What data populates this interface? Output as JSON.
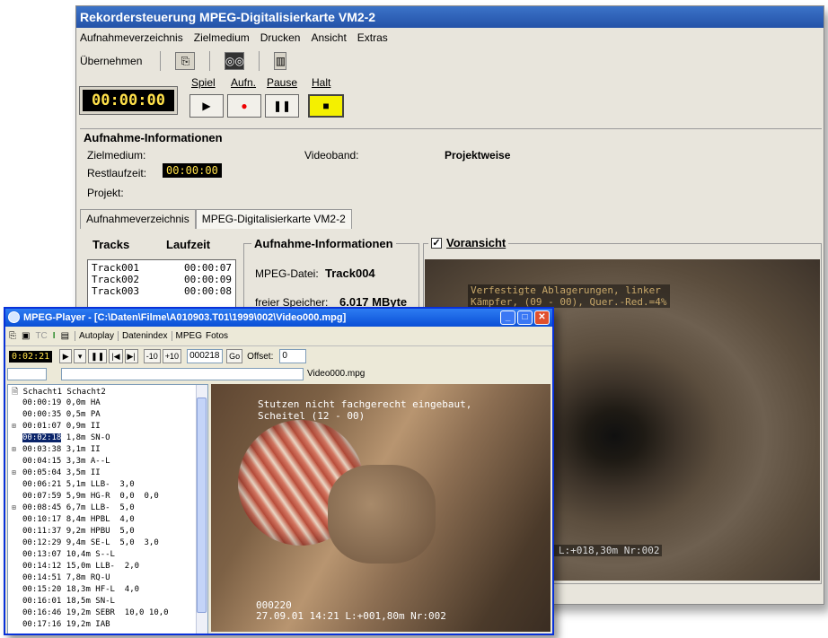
{
  "win1": {
    "title": "Rekordersteuerung MPEG-Digitalisierkarte VM2-2",
    "menu": [
      "Aufnahmeverzeichnis",
      "Zielmedium",
      "Drucken",
      "Ansicht",
      "Extras"
    ],
    "toolbar": {
      "uebernehmen": "Übernehmen"
    },
    "timecode": "00:00:00",
    "transport_labels": {
      "spiel": "Spiel",
      "aufn": "Aufn.",
      "pause": "Pause",
      "halt": "Halt"
    },
    "transport_symbols": {
      "play": "▶",
      "rec": "●",
      "pause": "❚❚",
      "stop": "■"
    },
    "aufnahme_info": {
      "title": "Aufnahme-Informationen",
      "zielmedium": "Zielmedium:",
      "videoband": "Videoband:",
      "projektweise": "Projektweise",
      "restlaufzeit": "Restlaufzeit:",
      "restlaufzeit_value": "00:00:00",
      "projekt": "Projekt:"
    },
    "tabs": [
      "Aufnahmeverzeichnis",
      "MPEG-Digitalisierkarte VM2-2"
    ],
    "tracks_header": {
      "tracks": "Tracks",
      "laufzeit": "Laufzeit"
    },
    "tracks": [
      {
        "name": "Track001",
        "time": "00:00:07"
      },
      {
        "name": "Track002",
        "time": "00:00:09"
      },
      {
        "name": "Track003",
        "time": "00:00:08"
      }
    ],
    "info2": {
      "title": "Aufnahme-Informationen",
      "mpeg_datei_label": "MPEG-Datei:",
      "mpeg_datei_value": "Track004",
      "speicher_label": "freier Speicher:",
      "speicher_value": "6.017 MByte"
    },
    "preview": {
      "label": "Voransicht",
      "checked": "✓",
      "osd_top": "Verfestigte Ablagerungen, linker\nKämpfer, (09 - 00), Quer.-Red.=4%",
      "osd_bottom": "34 L:+018,30m Nr:002"
    }
  },
  "win2": {
    "title": "MPEG-Player - [C:\\Daten\\Filme\\A010903.T01\\1999\\002\\Video000.mpg]",
    "toolbar": {
      "tc": "TC",
      "i": "I",
      "autoplay": "Autoplay",
      "datenindex": "Datenindex",
      "mpeg": "MPEG",
      "fotos": "Fotos"
    },
    "timecode": "0:02:21",
    "ctrl": {
      "play": "▶",
      "dropdown": "▾",
      "pause": "❚❚",
      "first": "|◀",
      "last": "▶|",
      "minus10": "-10",
      "plus10": "+10",
      "frame": "000218",
      "go": "Go",
      "offset_label": "Offset:",
      "offset_value": "0"
    },
    "filename": "Video000.mpg",
    "tree_root": "Schacht1 Schacht2",
    "tree": [
      {
        "tc": "00:00:19",
        "info": "0,0m HA",
        "exp": ""
      },
      {
        "tc": "00:00:35",
        "info": "0,5m PA",
        "exp": ""
      },
      {
        "tc": "00:01:07",
        "info": "0,9m II",
        "exp": "⊞"
      },
      {
        "tc": "00:02:18",
        "info": "1,8m SN-O",
        "exp": "",
        "selected": true
      },
      {
        "tc": "00:03:38",
        "info": "3,1m II",
        "exp": "⊞"
      },
      {
        "tc": "00:04:15",
        "info": "3,3m A--L",
        "exp": ""
      },
      {
        "tc": "00:05:04",
        "info": "3,5m II",
        "exp": "⊞"
      },
      {
        "tc": "00:06:21",
        "info": "5,1m LLB-  3,0",
        "exp": ""
      },
      {
        "tc": "00:07:59",
        "info": "5,9m HG-R  0,0  0,0",
        "exp": ""
      },
      {
        "tc": "00:08:45",
        "info": "6,7m LLB-  5,0",
        "exp": "⊞"
      },
      {
        "tc": "00:10:17",
        "info": "8,4m HPBL  4,0",
        "exp": ""
      },
      {
        "tc": "00:11:37",
        "info": "9,2m HPBU  5,0",
        "exp": ""
      },
      {
        "tc": "00:12:29",
        "info": "9,4m SE-L  5,0  3,0",
        "exp": ""
      },
      {
        "tc": "00:13:07",
        "info": "10,4m S--L",
        "exp": ""
      },
      {
        "tc": "00:14:12",
        "info": "15,0m LLB-  2,0",
        "exp": ""
      },
      {
        "tc": "00:14:51",
        "info": "7,8m RQ-U",
        "exp": ""
      },
      {
        "tc": "00:15:20",
        "info": "18,3m HF-L  4,0",
        "exp": ""
      },
      {
        "tc": "00:16:01",
        "info": "18,5m SN-L",
        "exp": ""
      },
      {
        "tc": "00:16:46",
        "info": "19,2m SEBR  10,0 10,0",
        "exp": ""
      },
      {
        "tc": "00:17:16",
        "info": "19,2m IAB",
        "exp": ""
      }
    ],
    "video_osd": {
      "top": "Stutzen nicht fachgerecht eingebaut,\nScheitel (12 - 00)",
      "bottom1": "000220",
      "bottom2": "27.09.01  14:21  L:+001,80m Nr:002"
    }
  }
}
